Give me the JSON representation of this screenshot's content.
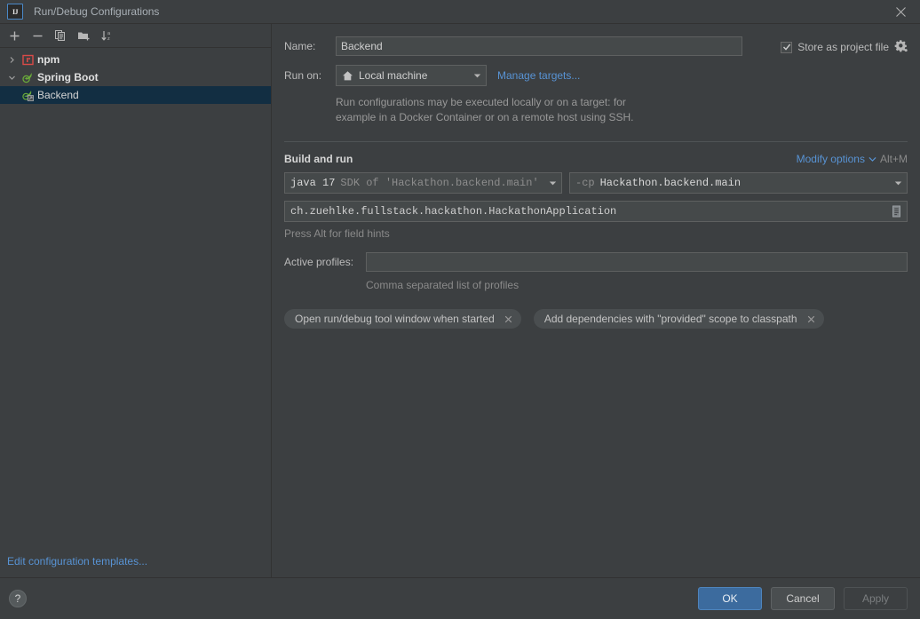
{
  "window": {
    "title": "Run/Debug Configurations",
    "logo_text": "IJ",
    "close_icon": "close-icon"
  },
  "tree_toolbar": {
    "buttons": [
      {
        "name": "add-configuration-button",
        "icon": "plus-icon",
        "tooltip": "Add New Configuration"
      },
      {
        "name": "remove-configuration-button",
        "icon": "minus-icon",
        "tooltip": "Remove Configuration"
      },
      {
        "name": "copy-configuration-button",
        "icon": "copy-icon",
        "tooltip": "Copy Configuration"
      },
      {
        "name": "new-folder-button",
        "icon": "new-folder-icon",
        "tooltip": "Create New Folder"
      },
      {
        "name": "sort-configurations-button",
        "icon": "sort-alphabetical-icon",
        "tooltip": "Sort Configurations"
      }
    ]
  },
  "tree": {
    "items": [
      {
        "label": "npm",
        "icon": "npm-icon",
        "level": 0,
        "expanded": false,
        "arrow": "chevron-right",
        "selected": false,
        "group": true
      },
      {
        "label": "Spring Boot",
        "icon": "spring-boot-icon",
        "level": 0,
        "expanded": true,
        "arrow": "chevron-down",
        "selected": false,
        "group": true
      },
      {
        "label": "Backend",
        "icon": "spring-boot-config-icon",
        "level": 1,
        "expanded": false,
        "arrow": "",
        "selected": true,
        "group": false
      }
    ]
  },
  "left_footer": {
    "edit_templates_label": "Edit configuration templates..."
  },
  "form": {
    "name_label": "Name:",
    "name_value": "Backend",
    "name_placeholder": "",
    "run_on_label": "Run on:",
    "run_on_value": "Local machine",
    "run_on_icon": "home-icon",
    "manage_targets_label": "Manage targets...",
    "store_as_project_file_label": "Store as project file",
    "store_as_project_file_checked": true,
    "store_gear_icon": "gear-icon",
    "description_line1": "Run configurations may be executed locally or on a target: for",
    "description_line2": "example in a Docker Container or on a remote host using SSH."
  },
  "build_and_run": {
    "section_title": "Build and run",
    "modify_options_label": "Modify options",
    "modify_options_icon": "chevron-down-icon",
    "modify_options_shortcut": "Alt+M",
    "jdk_name": "java 17",
    "jdk_description": "SDK of 'Hackathon.backend.main'",
    "classpath_flag": "-cp",
    "classpath_module": "Hackathon.backend.main",
    "main_class_value": "ch.zuehlke.fullstack.hackathon.HackathonApplication",
    "main_class_placeholder": "Main class",
    "main_class_browse_icon": "list-file-icon",
    "field_hint": "Press Alt for field hints",
    "active_profiles_label": "Active profiles:",
    "active_profiles_value": "",
    "active_profiles_placeholder": "",
    "active_profiles_hint": "Comma separated list of profiles",
    "chips": [
      {
        "label": "Open run/debug tool window when started",
        "remove_icon": "close-icon"
      },
      {
        "label": "Add dependencies with \"provided\" scope to classpath",
        "remove_icon": "close-icon"
      }
    ]
  },
  "bottom_bar": {
    "help_label": "?",
    "ok_label": "OK",
    "cancel_label": "Cancel",
    "apply_label": "Apply",
    "apply_enabled": false
  },
  "colors": {
    "background": "#3c3f41",
    "field_background": "#45494a",
    "selection": "#122e42",
    "link": "#5893d4",
    "primary_button": "#3c6b9e",
    "spring_green": "#6aab3a",
    "npm_red": "#d94b48",
    "text": "#bbbbbb",
    "muted_text": "#8a8a8a"
  }
}
